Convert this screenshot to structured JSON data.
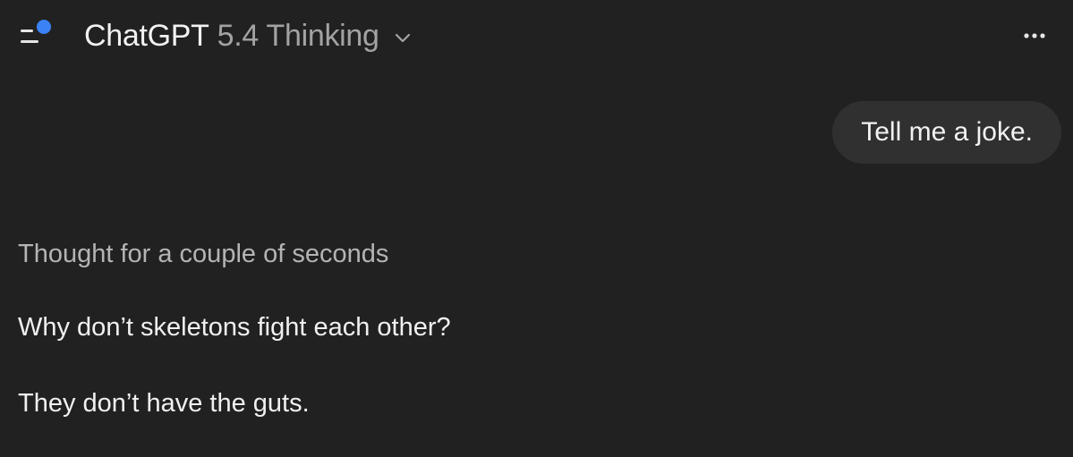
{
  "header": {
    "menu_icon": "sidebar-menu-icon",
    "notification_color": "#3b82f6",
    "model_name": "ChatGPT",
    "model_version": "5.4 Thinking",
    "chevron_icon": "chevron-down-icon",
    "more_icon": "ellipsis-icon"
  },
  "conversation": {
    "user_message": "Tell me a joke.",
    "thought_label": "Thought for a couple of seconds",
    "assistant_lines": [
      "Why don’t skeletons fight each other?",
      "They don’t have the guts."
    ]
  },
  "colors": {
    "background": "#212121",
    "bubble": "#303030",
    "text_primary": "#f0f0f0",
    "text_secondary": "#a3a3a3",
    "accent": "#3b82f6"
  }
}
